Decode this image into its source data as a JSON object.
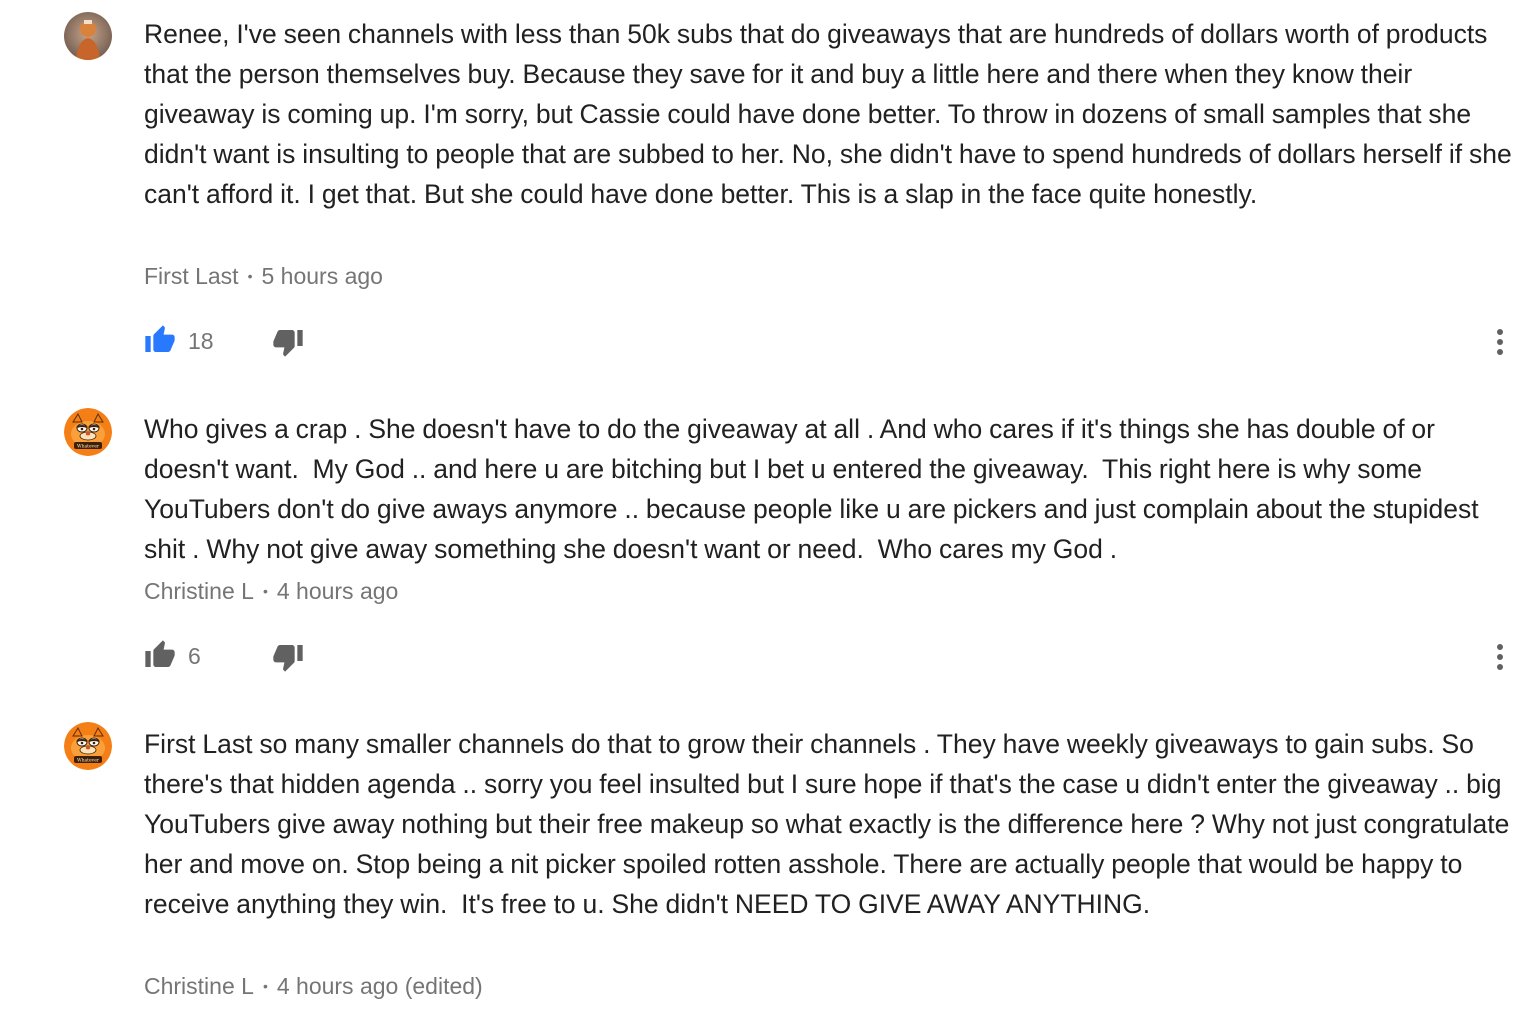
{
  "comments": [
    {
      "avatar_icon": "user-avatar-photo",
      "text": "Renee, I've seen channels with less than 50k subs that do giveaways that are hundreds of dollars worth of products that the person themselves buy. Because they save for it and buy a little here and there when they know their giveaway is coming up. I'm sorry, but Cassie could have done better. To throw in dozens of small samples that she didn't want is insulting to people that are subbed to her. No, she didn't have to spend hundreds of dollars herself if she can't afford it. I get that. But she could have done better. This is a slap in the face quite honestly.",
      "author": "First Last",
      "separator": "•",
      "time": "5 hours ago",
      "likes": "18",
      "liked": true
    },
    {
      "avatar_icon": "garfield-avatar",
      "avatar_caption": "Whatever",
      "text": "Who gives a crap . She doesn't have to do the giveaway at all . And who cares if it's things she has double of or doesn't want.  My God .. and here u are bitching but I bet u entered the giveaway.  This right here is why some YouTubers don't do give aways anymore .. because people like u are pickers and just complain about the stupidest shit . Why not give away something she doesn't want or need.  Who cares my God .",
      "author": "Christine L",
      "separator": "•",
      "time": "4 hours ago",
      "likes": "6",
      "liked": false
    },
    {
      "avatar_icon": "garfield-avatar",
      "avatar_caption": "Whatever",
      "text": "First Last so many smaller channels do that to grow their channels . They have weekly giveaways to gain subs. So there's that hidden agenda .. sorry you feel insulted but I sure hope if that's the case u didn't enter the giveaway .. big YouTubers give away nothing but their free makeup so what exactly is the difference here ? Why not just congratulate her and move on. Stop being a nit picker spoiled rotten asshole. There are actually people that would be happy to receive anything they win.  It's free to u. She didn't NEED TO GIVE AWAY ANYTHING.",
      "author": "Christine L",
      "separator": "•",
      "time": "4 hours ago (edited)"
    }
  ],
  "colors": {
    "text": "#212121",
    "meta": "#757575",
    "like_active": "#2979ff",
    "icon": "#616161",
    "garfield_orange": "#f57f17"
  }
}
